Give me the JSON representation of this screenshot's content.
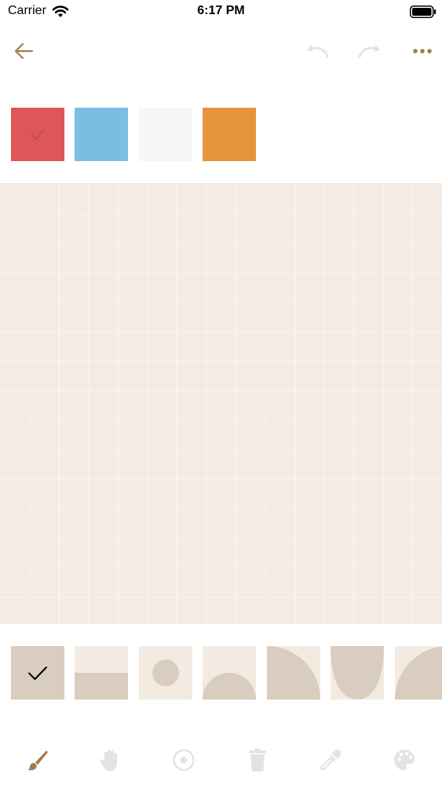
{
  "status": {
    "carrier": "Carrier",
    "time": "6:17 PM"
  },
  "colors": {
    "accent": "#a57a4e",
    "disabled": "#e3e3e3",
    "canvas_bg": "#f3ebe4",
    "grid_line": "#faf6f2",
    "tile_bg": "#f3ebe1",
    "tile_shape": "#d8cdbe"
  },
  "nav": {
    "back_icon": "arrow-left-icon",
    "undo_icon": "undo-icon",
    "redo_icon": "redo-icon",
    "more_icon": "ellipsis-icon"
  },
  "palette": {
    "selected_index": 0,
    "swatches": [
      {
        "color": "#e05558",
        "selected": true
      },
      {
        "color": "#7cbde3",
        "selected": false
      },
      {
        "color": "#f6f5f7",
        "selected": false
      },
      {
        "color": "#e6943e",
        "selected": false
      }
    ]
  },
  "shape_tiles": {
    "selected_index": 0,
    "items": [
      {
        "shape": "full-square",
        "selected": true
      },
      {
        "shape": "bottom-half"
      },
      {
        "shape": "center-dot"
      },
      {
        "shape": "bottom-semicircle"
      },
      {
        "shape": "quarter-circle"
      },
      {
        "shape": "bottom-parabola"
      },
      {
        "shape": "corner-arc"
      }
    ]
  },
  "toolbar": {
    "tools": [
      {
        "icon": "paintbrush-icon",
        "active": true
      },
      {
        "icon": "hand-icon",
        "active": false
      },
      {
        "icon": "target-icon",
        "active": false
      },
      {
        "icon": "trash-icon",
        "active": false
      },
      {
        "icon": "eyedropper-icon",
        "active": false
      },
      {
        "icon": "palette-icon",
        "active": false
      }
    ]
  }
}
